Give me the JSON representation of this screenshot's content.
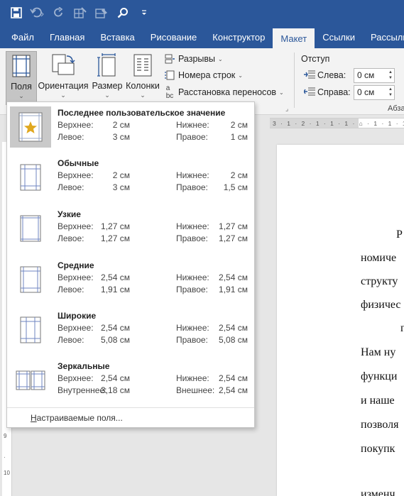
{
  "quick_access": {
    "icons": [
      "save-icon",
      "undo-icon",
      "redo-icon",
      "draw-table-icon",
      "eraser-icon",
      "search-icon",
      "customize-qat-icon"
    ]
  },
  "tabs": [
    {
      "label": "Файл",
      "active": false
    },
    {
      "label": "Главная",
      "active": false
    },
    {
      "label": "Вставка",
      "active": false
    },
    {
      "label": "Рисование",
      "active": false
    },
    {
      "label": "Конструктор",
      "active": false
    },
    {
      "label": "Макет",
      "active": true
    },
    {
      "label": "Ссылки",
      "active": false
    },
    {
      "label": "Рассылки",
      "active": false
    }
  ],
  "ribbon": {
    "margins_label": "Поля",
    "orientation_label": "Ориентация",
    "size_label": "Размер",
    "columns_label": "Колонки",
    "breaks_label": "Разрывы",
    "line_numbers_label": "Номера строк",
    "hyphenation_label": "Расстановка переносов",
    "indent_title": "Отступ",
    "indent_left_label": "Слева:",
    "indent_left_value": "0 см",
    "indent_right_label": "Справа:",
    "indent_right_value": "0 см",
    "paragraph_group_label": "Абза"
  },
  "margins_menu": {
    "presets": [
      {
        "name": "Последнее пользовательское значение",
        "icon": "custom-margins-star-icon",
        "label_a": "Верхнее:",
        "value_a": "2 см",
        "label_b": "Нижнее:",
        "value_b": "2 см",
        "label_c": "Левое:",
        "value_c": "3 см",
        "label_d": "Правое:",
        "value_d": "1 см",
        "selected": true
      },
      {
        "name": "Обычные",
        "icon": "normal-margins-icon",
        "label_a": "Верхнее:",
        "value_a": "2 см",
        "label_b": "Нижнее:",
        "value_b": "2 см",
        "label_c": "Левое:",
        "value_c": "3 см",
        "label_d": "Правое:",
        "value_d": "1,5 см",
        "selected": false
      },
      {
        "name": "Узкие",
        "icon": "narrow-margins-icon",
        "label_a": "Верхнее:",
        "value_a": "1,27 см",
        "label_b": "Нижнее:",
        "value_b": "1,27 см",
        "label_c": "Левое:",
        "value_c": "1,27 см",
        "label_d": "Правое:",
        "value_d": "1,27 см",
        "selected": false
      },
      {
        "name": "Средние",
        "icon": "moderate-margins-icon",
        "label_a": "Верхнее:",
        "value_a": "2,54 см",
        "label_b": "Нижнее:",
        "value_b": "2,54 см",
        "label_c": "Левое:",
        "value_c": "1,91 см",
        "label_d": "Правое:",
        "value_d": "1,91 см",
        "selected": false
      },
      {
        "name": "Широкие",
        "icon": "wide-margins-icon",
        "label_a": "Верхнее:",
        "value_a": "2,54 см",
        "label_b": "Нижнее:",
        "value_b": "2,54 см",
        "label_c": "Левое:",
        "value_c": "5,08 см",
        "label_d": "Правое:",
        "value_d": "5,08 см",
        "selected": false
      },
      {
        "name": "Зеркальные",
        "icon": "mirrored-margins-icon",
        "label_a": "Верхнее:",
        "value_a": "2,54 см",
        "label_b": "Нижнее:",
        "value_b": "2,54 см",
        "label_c": "Внутреннее:",
        "value_c": "3,18 см",
        "label_d": "Внешнее:",
        "value_d": "2,54 см",
        "selected": false
      }
    ],
    "custom_label_accel": "Н",
    "custom_label_rest": "астраиваемые поля..."
  },
  "ruler": {
    "horizontal_text": "3 · 1 · 2 · 1 · 1 · 1 · ⌂ · 1 · 1 · 1"
  },
  "document": {
    "lines": [
      "Р",
      "номиче",
      "структу",
      "физичес",
      "г",
      "Нам ну",
      "функци",
      "и  наше",
      "позволя",
      "покупк",
      "изменч"
    ]
  },
  "colors": {
    "title_bar": "#2b579a",
    "ribbon_bg": "#f3f3f3",
    "accent": "#2b579a"
  }
}
